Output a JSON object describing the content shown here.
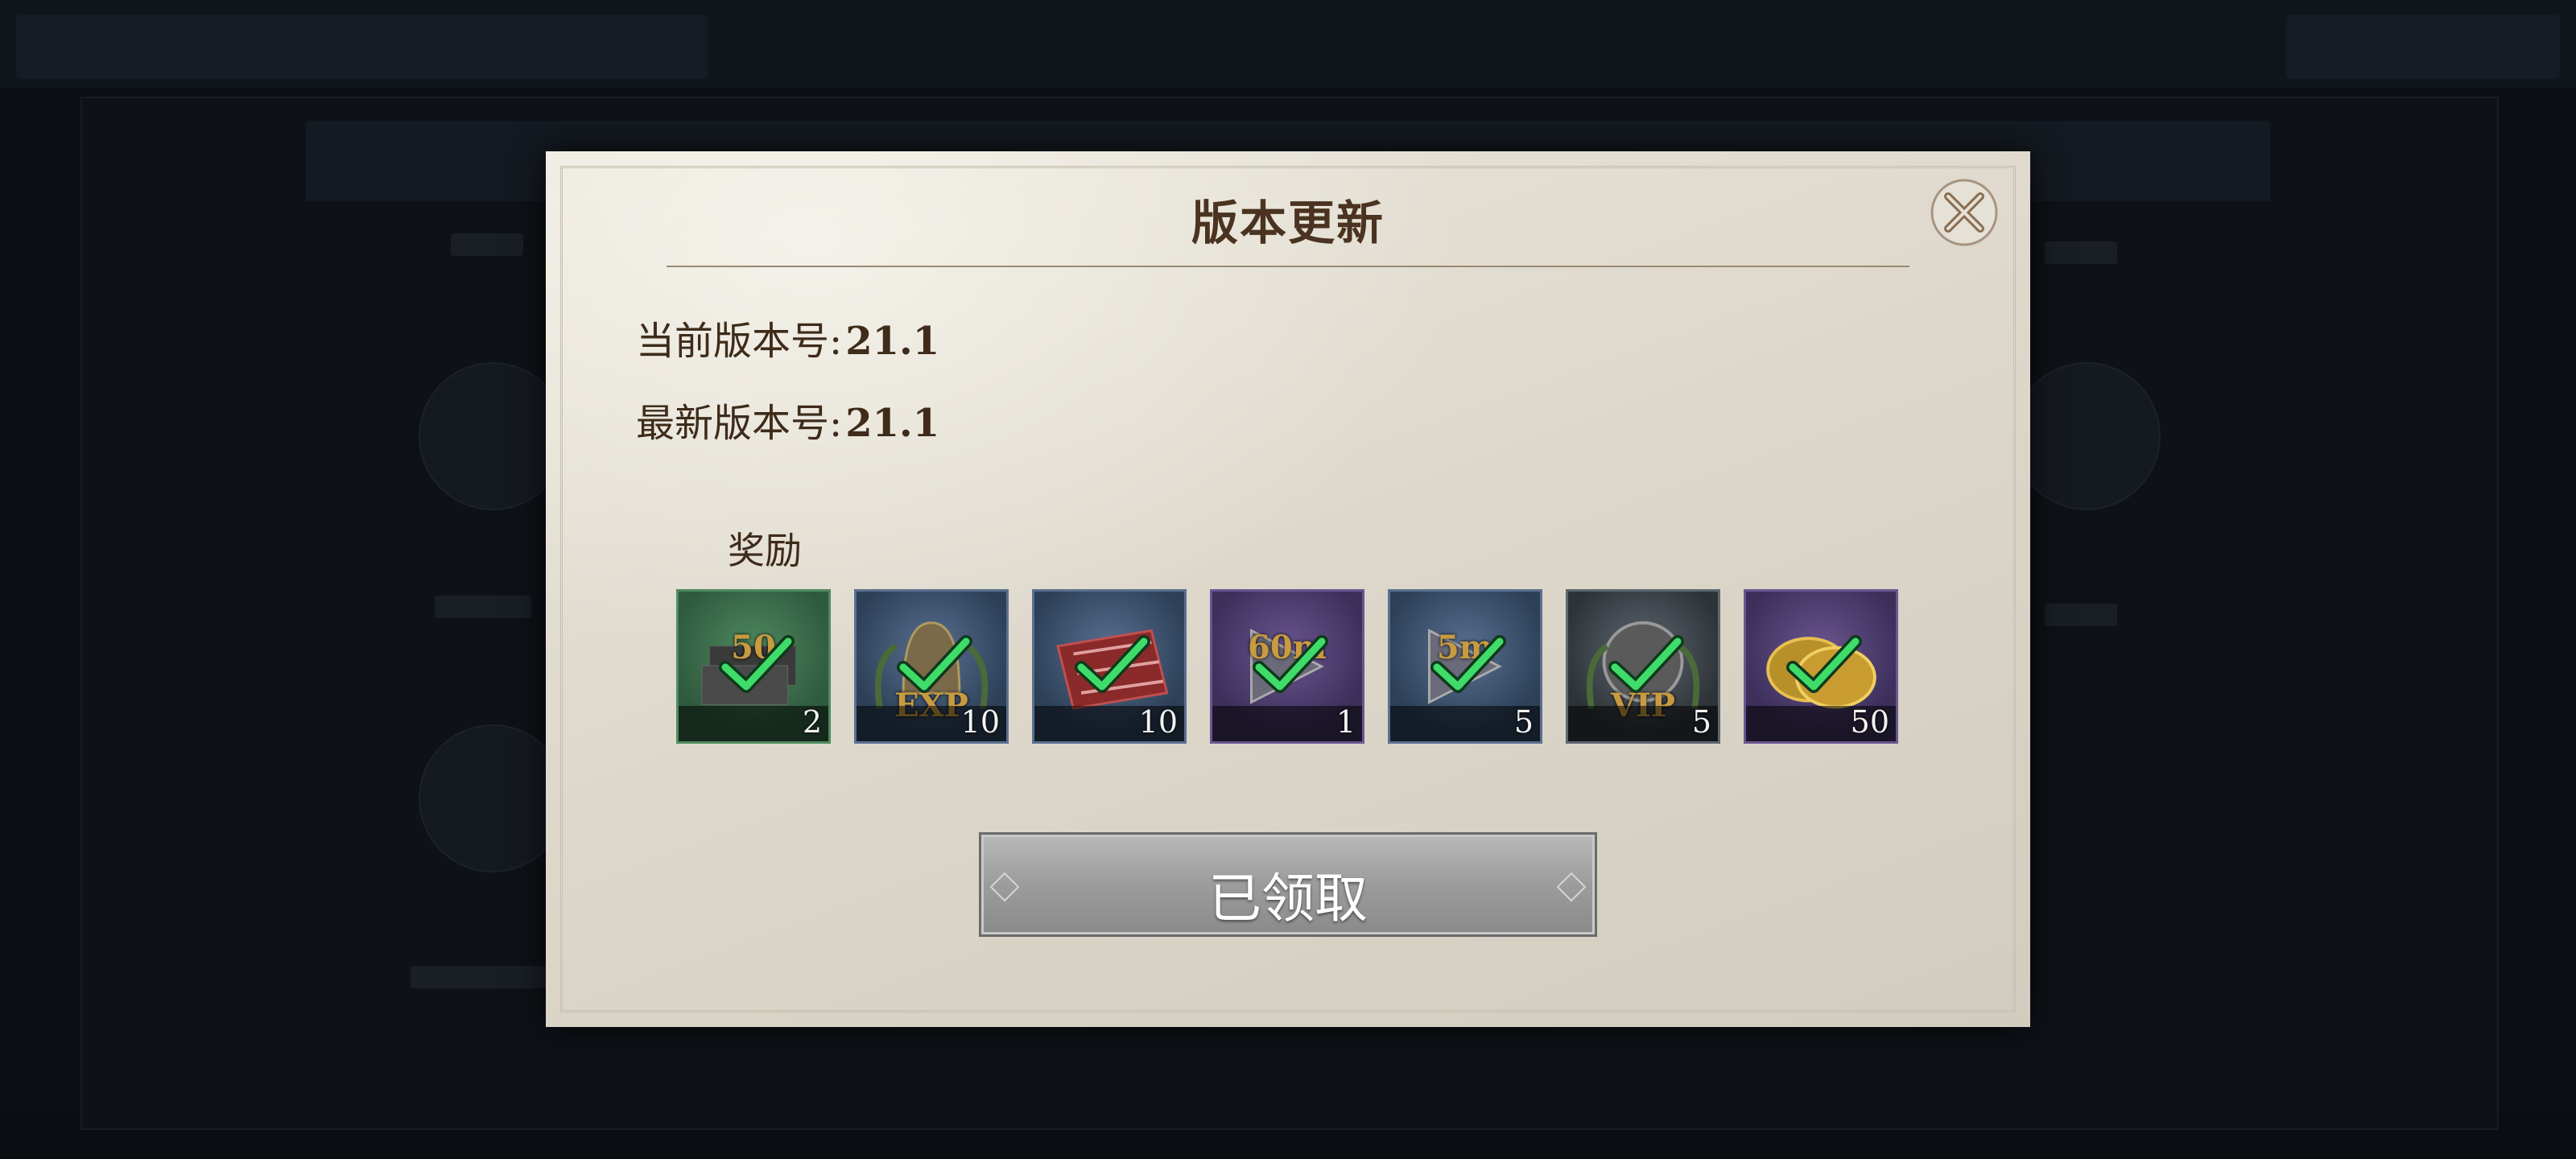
{
  "dialog": {
    "title": "版本更新",
    "current_version_label": "当前版本号:",
    "current_version_value": "21.1",
    "latest_version_label": "最新版本号:",
    "latest_version_value": "21.1",
    "rewards_label": "奖励",
    "claim_button_label": "已领取"
  },
  "rewards": [
    {
      "name": "iron-ingot",
      "qty": "2",
      "overlay": "50",
      "bg": "#2f5a3e",
      "border": "#4f8a5e"
    },
    {
      "name": "exp-helmet",
      "qty": "10",
      "overlay": "EXP",
      "bg": "#2c4058",
      "border": "#5a7090"
    },
    {
      "name": "meat",
      "qty": "10",
      "overlay": "",
      "bg": "#2c4058",
      "border": "#5a7090"
    },
    {
      "name": "speedup-60m",
      "qty": "1",
      "overlay": "60m",
      "bg": "#3c2f5a",
      "border": "#6a5690"
    },
    {
      "name": "speedup-5m",
      "qty": "5",
      "overlay": "5m",
      "bg": "#2c4058",
      "border": "#5a7090"
    },
    {
      "name": "vip-badge",
      "qty": "5",
      "overlay": "VIP",
      "bg": "#2e3338",
      "border": "#5e6670"
    },
    {
      "name": "gold-coins",
      "qty": "50",
      "overlay": "",
      "bg": "#3c2f5a",
      "border": "#6a5690"
    }
  ],
  "colors": {
    "check": "#3fdc6a",
    "parchment": "#e2ddd1",
    "title_text": "#4a3320"
  }
}
